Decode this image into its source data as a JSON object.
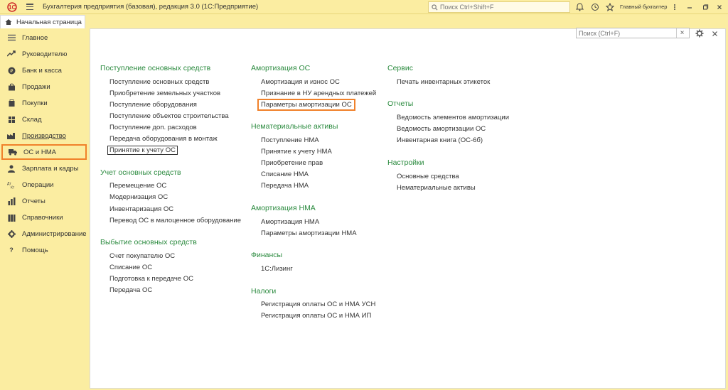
{
  "app": {
    "title": "Бухгалтерия предприятия (базовая), редакция 3.0  (1С:Предприятие)",
    "search_placeholder": "Поиск Ctrl+Shift+F",
    "user": "Главный бухгалтер",
    "logo_text": "1С"
  },
  "colors": {
    "accent_green": "#2a8a3e",
    "highlight_orange": "#f0812a",
    "chrome_yellow": "#fbeda1"
  },
  "tabs": {
    "home_label": "Начальная страница"
  },
  "sidebar": {
    "items": [
      {
        "label": "Главное",
        "icon": "list-icon"
      },
      {
        "label": "Руководителю",
        "icon": "trend-icon"
      },
      {
        "label": "Банк и касса",
        "icon": "coins-icon"
      },
      {
        "label": "Продажи",
        "icon": "bag-icon"
      },
      {
        "label": "Покупки",
        "icon": "cart-icon"
      },
      {
        "label": "Склад",
        "icon": "warehouse-icon"
      },
      {
        "label": "Производство",
        "icon": "factory-icon"
      },
      {
        "label": "ОС и НМА",
        "icon": "truck-icon"
      },
      {
        "label": "Зарплата и кадры",
        "icon": "people-icon"
      },
      {
        "label": "Операции",
        "icon": "dt-kt-icon"
      },
      {
        "label": "Отчеты",
        "icon": "bar-chart-icon"
      },
      {
        "label": "Справочники",
        "icon": "books-icon"
      },
      {
        "label": "Администрирование",
        "icon": "gear-icon"
      },
      {
        "label": "Помощь",
        "icon": "question-icon"
      }
    ]
  },
  "main": {
    "search_placeholder": "Поиск (Ctrl+F)",
    "col1": {
      "s1": {
        "title": "Поступление основных средств",
        "links": [
          "Поступление основных средств",
          "Приобретение земельных участков",
          "Поступление оборудования",
          "Поступление объектов строительства",
          "Поступление доп. расходов",
          "Передача оборудования в монтаж",
          "Принятие к учету ОС"
        ]
      },
      "s2": {
        "title": "Учет основных средств",
        "links": [
          "Перемещение ОС",
          "Модернизация ОС",
          "Инвентаризация ОС",
          "Перевод ОС в малоценное оборудование"
        ]
      },
      "s3": {
        "title": "Выбытие основных средств",
        "links": [
          "Счет покупателю ОС",
          "Списание ОС",
          "Подготовка к передаче ОС",
          "Передача ОС"
        ]
      }
    },
    "col2": {
      "s1": {
        "title": "Амортизация ОС",
        "links": [
          "Амортизация и износ ОС",
          "Признание в НУ арендных платежей",
          "Параметры амортизации ОС"
        ]
      },
      "s2": {
        "title": "Нематериальные активы",
        "links": [
          "Поступление НМА",
          "Принятие к учету НМА",
          "Приобретение прав",
          "Списание НМА",
          "Передача НМА"
        ]
      },
      "s3": {
        "title": "Амортизация НМА",
        "links": [
          "Амортизация НМА",
          "Параметры амортизации НМА"
        ]
      },
      "s4": {
        "title": "Финансы",
        "links": [
          "1С:Лизинг"
        ]
      },
      "s5": {
        "title": "Налоги",
        "links": [
          "Регистрация оплаты ОС и НМА УСН",
          "Регистрация оплаты ОС и НМА ИП"
        ]
      }
    },
    "col3": {
      "s1": {
        "title": "Сервис",
        "links": [
          "Печать инвентарных этикеток"
        ]
      },
      "s2": {
        "title": "Отчеты",
        "links": [
          "Ведомость элементов амортизации",
          "Ведомость амортизации ОС",
          "Инвентарная книга (ОС-6б)"
        ]
      },
      "s3": {
        "title": "Настройки",
        "links": [
          "Основные средства",
          "Нематериальные активы"
        ]
      }
    }
  }
}
